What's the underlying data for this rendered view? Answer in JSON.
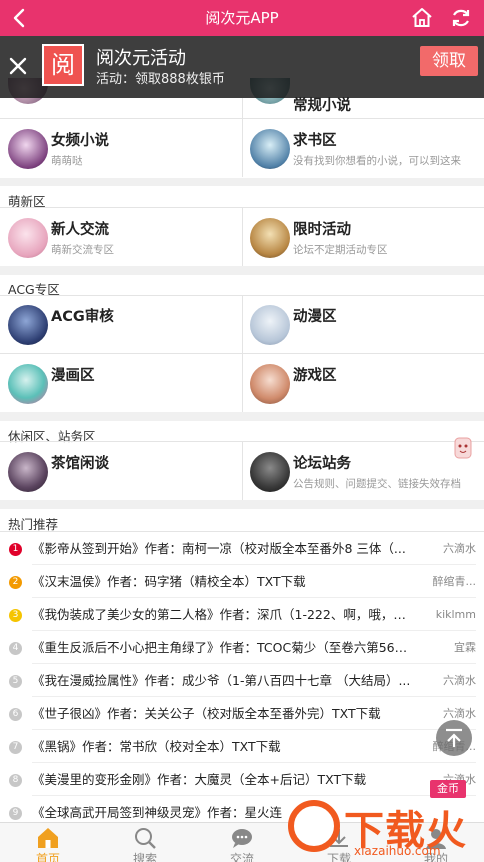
{
  "header": {
    "title": "阅次元APP",
    "back_icon": "back-arrow-icon",
    "home_icon": "home-icon",
    "refresh_icon": "refresh-icon"
  },
  "banner": {
    "logo_char": "阅",
    "title": "阅次元活动",
    "subtitle": "活动：领取888枚银币",
    "claim_label": "领取"
  },
  "top_partial": {
    "left_name": "",
    "right_name": "常规小说"
  },
  "section1": {
    "items": [
      {
        "name": "女频小说",
        "desc": "萌萌哒"
      },
      {
        "name": "求书区",
        "desc": "没有找到你想看的小说，可以到这来"
      }
    ]
  },
  "section2": {
    "title": "萌新区",
    "items": [
      {
        "name": "新人交流",
        "desc": "萌新交流专区"
      },
      {
        "name": "限时活动",
        "desc": "论坛不定期活动专区"
      }
    ]
  },
  "section3": {
    "title": "ACG专区",
    "items": [
      {
        "name": "ACG审核",
        "desc": ""
      },
      {
        "name": "动漫区",
        "desc": ""
      },
      {
        "name": "漫画区",
        "desc": ""
      },
      {
        "name": "游戏区",
        "desc": ""
      }
    ]
  },
  "section4": {
    "title": "休闲区、站务区",
    "items": [
      {
        "name": "茶馆闲谈",
        "desc": ""
      },
      {
        "name": "论坛站务",
        "desc": "公告规则、问题提交、链接失效存档"
      }
    ]
  },
  "hot": {
    "title": "热门推荐",
    "rows": [
      {
        "rank": "1",
        "color": "#e0002a",
        "text": "《影帝从签到开始》作者：南柯一凉（校对版全本至番外8 三体（...",
        "author": "六滴水"
      },
      {
        "rank": "2",
        "color": "#f39a00",
        "text": "《汉末温侯》作者：码字猪（精校全本）TXT下载",
        "author": "醉绾青..."
      },
      {
        "rank": "3",
        "color": "#f5c400",
        "text": "《我伪装成了美少女的第二人格》作者：深爪（1-222、啊，哦，嗯...",
        "author": "kiklmm"
      },
      {
        "rank": "4",
        "color": "#c7c7c7",
        "text": "《重生反派后不小心把主角绿了》作者：TCOC菊少（至卷六第56章...",
        "author": "宜霖"
      },
      {
        "rank": "5",
        "color": "#c7c7c7",
        "text": "《我在漫威捡属性》作者：成少爷（1-第八百四十七章 （大结局）...",
        "author": "六滴水"
      },
      {
        "rank": "6",
        "color": "#c7c7c7",
        "text": "《世子很凶》作者：关关公子（校对版全本至番外完）TXT下载",
        "author": "六滴水"
      },
      {
        "rank": "7",
        "color": "#c7c7c7",
        "text": "《黑锅》作者：常书欣（校对全本）TXT下载",
        "author": "醉绾青..."
      },
      {
        "rank": "8",
        "color": "#c7c7c7",
        "text": "《美漫里的变形金刚》作者：大魔灵（全本+后记）TXT下载",
        "author": "六滴水"
      },
      {
        "rank": "9",
        "color": "#c7c7c7",
        "text": "《全球高武开局签到神级灵宠》作者：星火连",
        "author": ""
      }
    ]
  },
  "tabs": [
    {
      "label": "首页",
      "active": true,
      "icon": "home-tab-icon"
    },
    {
      "label": "搜索",
      "active": false,
      "icon": "search-icon"
    },
    {
      "label": "交流",
      "active": false,
      "icon": "chat-icon"
    },
    {
      "label": "下载",
      "active": false,
      "icon": "download-icon"
    },
    {
      "label": "我的",
      "active": false,
      "icon": "user-icon"
    }
  ],
  "watermark": {
    "coin_label": "金币",
    "big_text": "下载火",
    "url_text": "xiazaihuo.com"
  },
  "colors": {
    "brand": "#e8336d",
    "active_tab": "#e8336d",
    "watermark": "#f15a1f"
  }
}
